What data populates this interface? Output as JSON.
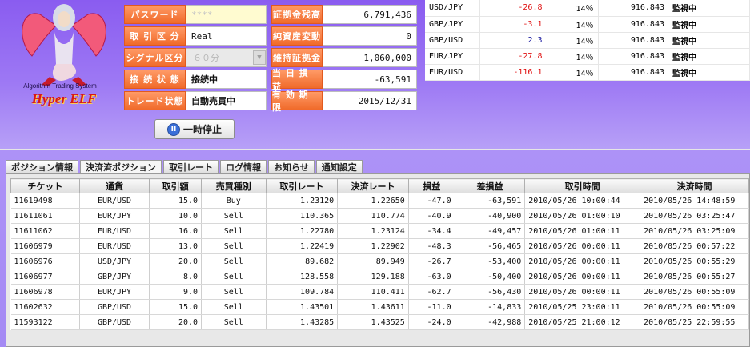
{
  "logo": {
    "subtitle": "Algorithm Trading System",
    "brand": "Hyper ELF"
  },
  "info_left": [
    {
      "label": "パスワード",
      "value": "****"
    },
    {
      "label": "取 引 区 分",
      "value": "Real"
    },
    {
      "label": "シグナル区分",
      "value": "６０分"
    },
    {
      "label": "接 続 状 態",
      "value": "接続中"
    },
    {
      "label": "トレード状態",
      "value": "自動売買中"
    }
  ],
  "info_right": [
    {
      "label": "証拠金残高",
      "value": "6,791,436"
    },
    {
      "label": "純資産変動",
      "value": "0"
    },
    {
      "label": "維持証拠金",
      "value": "1,060,000"
    },
    {
      "label": "当 日 損 益",
      "value": "-63,591"
    },
    {
      "label": "有 効 期 限",
      "value": "2015/12/31"
    }
  ],
  "pause_button": "一時停止",
  "rates": [
    {
      "pair": "USD/JPY",
      "change": "-26.8",
      "pct": "14％",
      "amount": "916.843",
      "status": "監視中"
    },
    {
      "pair": "GBP/JPY",
      "change": "-3.1",
      "pct": "14％",
      "amount": "916.843",
      "status": "監視中"
    },
    {
      "pair": "GBP/USD",
      "change": "2.3",
      "pct": "14％",
      "amount": "916.843",
      "status": "監視中"
    },
    {
      "pair": "EUR/JPY",
      "change": "-27.8",
      "pct": "14％",
      "amount": "916.843",
      "status": "監視中"
    },
    {
      "pair": "EUR/USD",
      "change": "-116.1",
      "pct": "14％",
      "amount": "916.843",
      "status": "監視中"
    }
  ],
  "tabs": [
    "ポジション情報",
    "決済済ポジション",
    "取引レート",
    "ログ情報",
    "お知らせ",
    "通知設定"
  ],
  "columns": [
    "チケット",
    "通貨",
    "取引額",
    "売買種別",
    "取引レート",
    "決済レート",
    "損益",
    "差損益",
    "取引時間",
    "決済時間"
  ],
  "rows": [
    [
      "11619498",
      "EUR/USD",
      "15.0",
      "Buy",
      "1.23120",
      "1.22650",
      "-47.0",
      "-63,591",
      "2010/05/26 10:00:44",
      "2010/05/26 14:48:59"
    ],
    [
      "11611061",
      "EUR/JPY",
      "10.0",
      "Sell",
      "110.365",
      "110.774",
      "-40.9",
      "-40,900",
      "2010/05/26 01:00:10",
      "2010/05/26 03:25:47"
    ],
    [
      "11611062",
      "EUR/USD",
      "16.0",
      "Sell",
      "1.22780",
      "1.23124",
      "-34.4",
      "-49,457",
      "2010/05/26 01:00:11",
      "2010/05/26 03:25:09"
    ],
    [
      "11606979",
      "EUR/USD",
      "13.0",
      "Sell",
      "1.22419",
      "1.22902",
      "-48.3",
      "-56,465",
      "2010/05/26 00:00:11",
      "2010/05/26 00:57:22"
    ],
    [
      "11606976",
      "USD/JPY",
      "20.0",
      "Sell",
      "89.682",
      "89.949",
      "-26.7",
      "-53,400",
      "2010/05/26 00:00:11",
      "2010/05/26 00:55:29"
    ],
    [
      "11606977",
      "GBP/JPY",
      "8.0",
      "Sell",
      "128.558",
      "129.188",
      "-63.0",
      "-50,400",
      "2010/05/26 00:00:11",
      "2010/05/26 00:55:27"
    ],
    [
      "11606978",
      "EUR/JPY",
      "9.0",
      "Sell",
      "109.784",
      "110.411",
      "-62.7",
      "-56,430",
      "2010/05/26 00:00:11",
      "2010/05/26 00:55:09"
    ],
    [
      "11602632",
      "GBP/USD",
      "15.0",
      "Sell",
      "1.43501",
      "1.43611",
      "-11.0",
      "-14,833",
      "2010/05/25 23:00:11",
      "2010/05/26 00:55:09"
    ],
    [
      "11593122",
      "GBP/USD",
      "20.0",
      "Sell",
      "1.43285",
      "1.43525",
      "-24.0",
      "-42,988",
      "2010/05/25 21:00:12",
      "2010/05/25 22:59:55"
    ]
  ],
  "colors": {
    "negative": "#e01010",
    "positive": "#1a1aa0",
    "label_orange": "#f06a2a",
    "background_purple": "#9d78f4"
  }
}
